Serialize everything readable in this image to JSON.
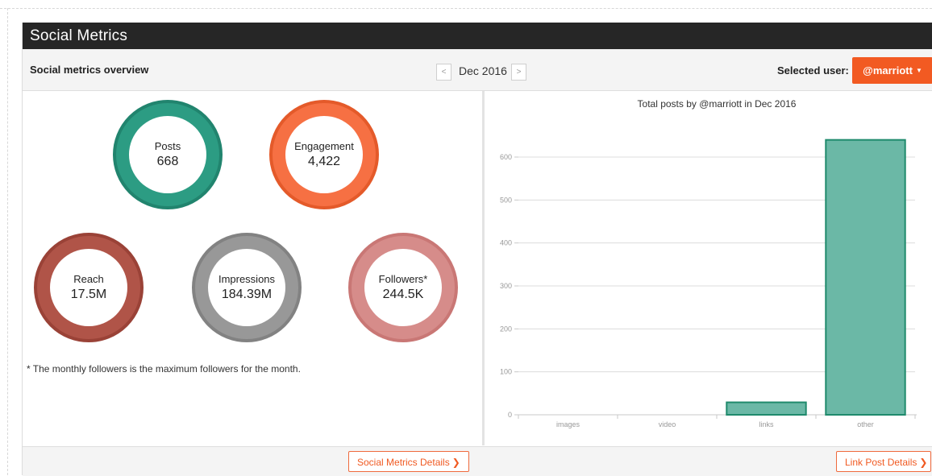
{
  "window": {
    "title": "Social Metrics"
  },
  "toolbar": {
    "overview_label": "Social metrics overview",
    "prev_symbol": "<",
    "month": "Dec 2016",
    "next_symbol": ">",
    "selected_user_label": "Selected user:",
    "user_button": "@marriott",
    "user_caret": "▼"
  },
  "metrics": {
    "posts": {
      "label": "Posts",
      "value": "668",
      "color": "#2c9c83"
    },
    "engagement": {
      "label": "Engagement",
      "value": "4,422",
      "color": "#f67043"
    },
    "reach": {
      "label": "Reach",
      "value": "17.5M",
      "color": "#b05448"
    },
    "impressions": {
      "label": "Impressions",
      "value": "184.39M",
      "color": "#989898"
    },
    "followers": {
      "label": "Followers*",
      "value": "244.5K",
      "color": "#d68c8a"
    }
  },
  "footnote": "* The monthly followers is the maximum followers for the month.",
  "footer": {
    "social_details": "Social Metrics Details",
    "link_details": "Link Post Details",
    "chevron": "❯"
  },
  "chart_data": {
    "type": "bar",
    "title": "Total posts by @marriott in Dec 2016",
    "categories": [
      "images",
      "video",
      "links",
      "other"
    ],
    "values": [
      0,
      0,
      29,
      640
    ],
    "ylim": [
      0,
      600
    ],
    "yticks": [
      0,
      100,
      200,
      300,
      400,
      500,
      600
    ],
    "grid": true,
    "bar_color": "#6bb8a6",
    "bar_edge_color": "#1f8a6c",
    "xlabel": "",
    "ylabel": ""
  }
}
